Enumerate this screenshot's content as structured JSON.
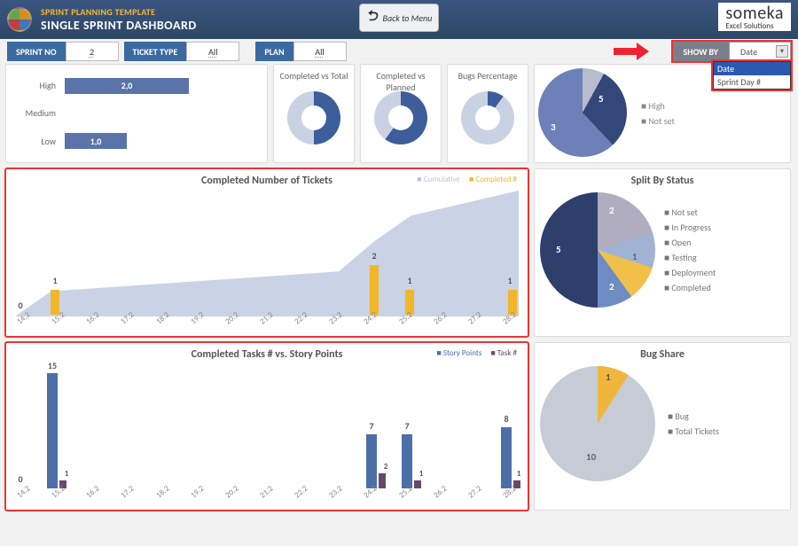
{
  "header": {
    "template_name": "SPRINT PLANNING TEMPLATE",
    "dashboard_name": "SINGLE SPRINT DASHBOARD",
    "back_label": "Back to Menu",
    "brand_top": "someka",
    "brand_sub": "Excel Solutions"
  },
  "filters": {
    "sprint_no_label": "SPRINT NO",
    "sprint_no_value": "2",
    "ticket_type_label": "TICKET TYPE",
    "ticket_type_value": "All",
    "plan_label": "PLAN",
    "plan_value": "All",
    "show_by_label": "SHOW BY",
    "show_by_value": "Date",
    "show_by_options": [
      "Date",
      "Sprint Day #"
    ]
  },
  "priority": {
    "rows": [
      {
        "label": "High",
        "value": "2,0",
        "width": 140
      },
      {
        "label": "Medium",
        "value": "",
        "width": 0
      },
      {
        "label": "Low",
        "value": "1,0",
        "width": 70
      }
    ]
  },
  "donuts": {
    "items": [
      {
        "title": "Completed vs Total",
        "pct": 50,
        "fg": "#3d5e9a",
        "bg": "#c9d2e3"
      },
      {
        "title": "Completed vs Planned",
        "pct": 60,
        "fg": "#3d5e9a",
        "bg": "#c9d2e3"
      },
      {
        "title": "Bugs Percentage",
        "pct": 10,
        "fg": "#3d5e9a",
        "bg": "#c9d2e3"
      }
    ]
  },
  "right_top_pie": {
    "legend": [
      "High",
      "Not set"
    ],
    "slices": [
      {
        "label": "3",
        "color": "#34477a"
      },
      {
        "label": "5",
        "color": "#6d80b7"
      }
    ]
  },
  "chart_data": [
    {
      "type": "bar+area",
      "title": "Completed Number of Tickets",
      "legend": [
        "Cumulative",
        "Completed #"
      ],
      "categories": [
        "14.2",
        "15.2",
        "16.2",
        "17.2",
        "18.2",
        "19.2",
        "20.2",
        "21.2",
        "22.2",
        "23.2",
        "24.2",
        "25.2",
        "26.2",
        "27.2",
        "28.2"
      ],
      "series": [
        {
          "name": "Cumulative",
          "type": "area",
          "values": [
            0,
            1,
            1,
            1,
            1,
            1,
            1,
            1,
            1,
            1,
            3,
            4,
            4,
            4,
            5
          ]
        },
        {
          "name": "Completed #",
          "type": "bar",
          "values": [
            0,
            1,
            0,
            0,
            0,
            0,
            0,
            0,
            0,
            0,
            2,
            1,
            0,
            0,
            1
          ]
        }
      ],
      "ylim": [
        0,
        5
      ]
    },
    {
      "type": "bar",
      "title": "Completed Tasks # vs. Story Points",
      "legend": [
        "Story Points",
        "Task #"
      ],
      "categories": [
        "14.2",
        "15.2",
        "16.2",
        "17.2",
        "18.2",
        "19.2",
        "20.2",
        "21.2",
        "22.2",
        "23.2",
        "24.2",
        "25.2",
        "26.2",
        "27.2",
        "28.2"
      ],
      "series": [
        {
          "name": "Story Points",
          "color": "#4c6fa8",
          "values": [
            0,
            15,
            0,
            0,
            0,
            0,
            0,
            0,
            0,
            0,
            7,
            7,
            0,
            0,
            8
          ]
        },
        {
          "name": "Task #",
          "color": "#6a476f",
          "values": [
            0,
            1,
            0,
            0,
            0,
            0,
            0,
            0,
            0,
            0,
            2,
            1,
            0,
            0,
            1
          ]
        }
      ],
      "ylim": [
        0,
        15
      ]
    },
    {
      "type": "pie",
      "title": "Split By Status",
      "slices": [
        {
          "label": "Not set",
          "value": 2,
          "color": "#b0adc0"
        },
        {
          "label": "In Progress",
          "value": 1,
          "color": "#4c6fa8"
        },
        {
          "label": "Open",
          "value": 1,
          "color": "#a0b3d4"
        },
        {
          "label": "Testing",
          "value": 1,
          "color": "#f0c04a"
        },
        {
          "label": "Deployment",
          "value": 0,
          "color": "#8fa5cd"
        },
        {
          "label": "Completed",
          "value": 5,
          "color": "#2e3f6b"
        }
      ]
    },
    {
      "type": "pie",
      "title": "Bug Share",
      "slices": [
        {
          "label": "Bug",
          "value": 1,
          "color": "#f0b63c"
        },
        {
          "label": "Total Tickets",
          "value": 10,
          "color": "#c6ccd6"
        }
      ]
    }
  ]
}
